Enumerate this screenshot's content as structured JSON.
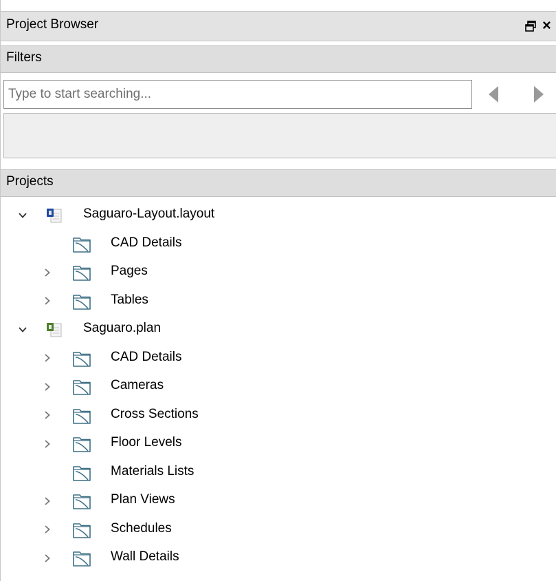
{
  "panel": {
    "title": "Project Browser",
    "float_icon": "restore-window-icon",
    "close_label": "×"
  },
  "filters": {
    "header": "Filters",
    "search_placeholder": "Type to start searching...",
    "search_value": "",
    "prev_icon": "left-triangle-icon",
    "next_icon": "right-triangle-icon"
  },
  "projects": {
    "header": "Projects",
    "files": [
      {
        "name": "Saguaro-Layout.layout",
        "icon": "layout-file-icon",
        "expanded": true,
        "folders": [
          {
            "label": "CAD Details",
            "expandable": false
          },
          {
            "label": "Pages",
            "expandable": true
          },
          {
            "label": "Tables",
            "expandable": true
          }
        ]
      },
      {
        "name": "Saguaro.plan",
        "icon": "plan-file-icon",
        "expanded": true,
        "folders": [
          {
            "label": "CAD Details",
            "expandable": true
          },
          {
            "label": "Cameras",
            "expandable": true
          },
          {
            "label": "Cross Sections",
            "expandable": true
          },
          {
            "label": "Floor Levels",
            "expandable": true
          },
          {
            "label": "Materials Lists",
            "expandable": false
          },
          {
            "label": "Plan Views",
            "expandable": true
          },
          {
            "label": "Schedules",
            "expandable": true
          },
          {
            "label": "Wall Details",
            "expandable": true
          }
        ]
      }
    ]
  },
  "colors": {
    "header_bg": "#e3e3e3",
    "folder_stroke": "#3d6f86",
    "layout_badge": "#1f4a9e",
    "plan_badge": "#4f7f2a",
    "arrow_gray": "#9a9a9a"
  }
}
